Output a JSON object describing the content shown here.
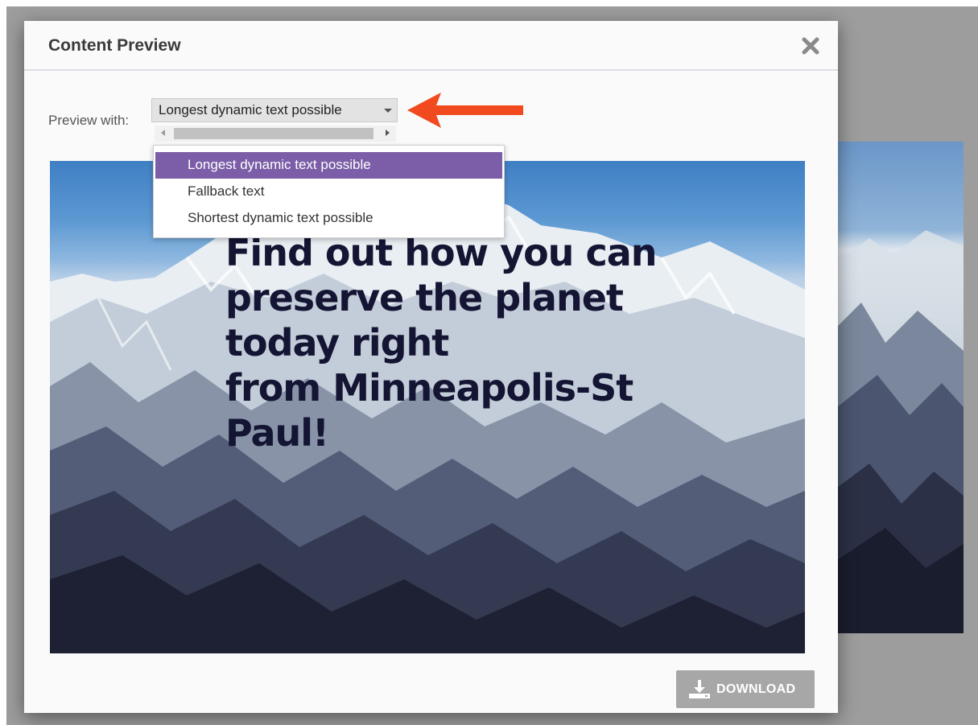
{
  "modal": {
    "title": "Content Preview"
  },
  "preview": {
    "label": "Preview with:",
    "selected": "Longest dynamic text possible",
    "options": [
      "Longest dynamic text possible",
      "Fallback text",
      "Shortest dynamic text possible"
    ],
    "selected_index": 0
  },
  "image": {
    "headline_lines": [
      "Find out how you can",
      "preserve the planet",
      "today right",
      "from Minneapolis-St",
      "Paul!"
    ]
  },
  "actions": {
    "download_label": "DOWNLOAD"
  },
  "icons": {
    "close": "close-icon",
    "download": "download-icon",
    "caret": "caret-down-icon",
    "annotation": "red-arrow-icon"
  },
  "colors": {
    "selected_option": "#7b5ea7",
    "annotation_arrow": "#f04a1e",
    "download_button": "#a7a7a7",
    "headline_text": "#141433"
  }
}
